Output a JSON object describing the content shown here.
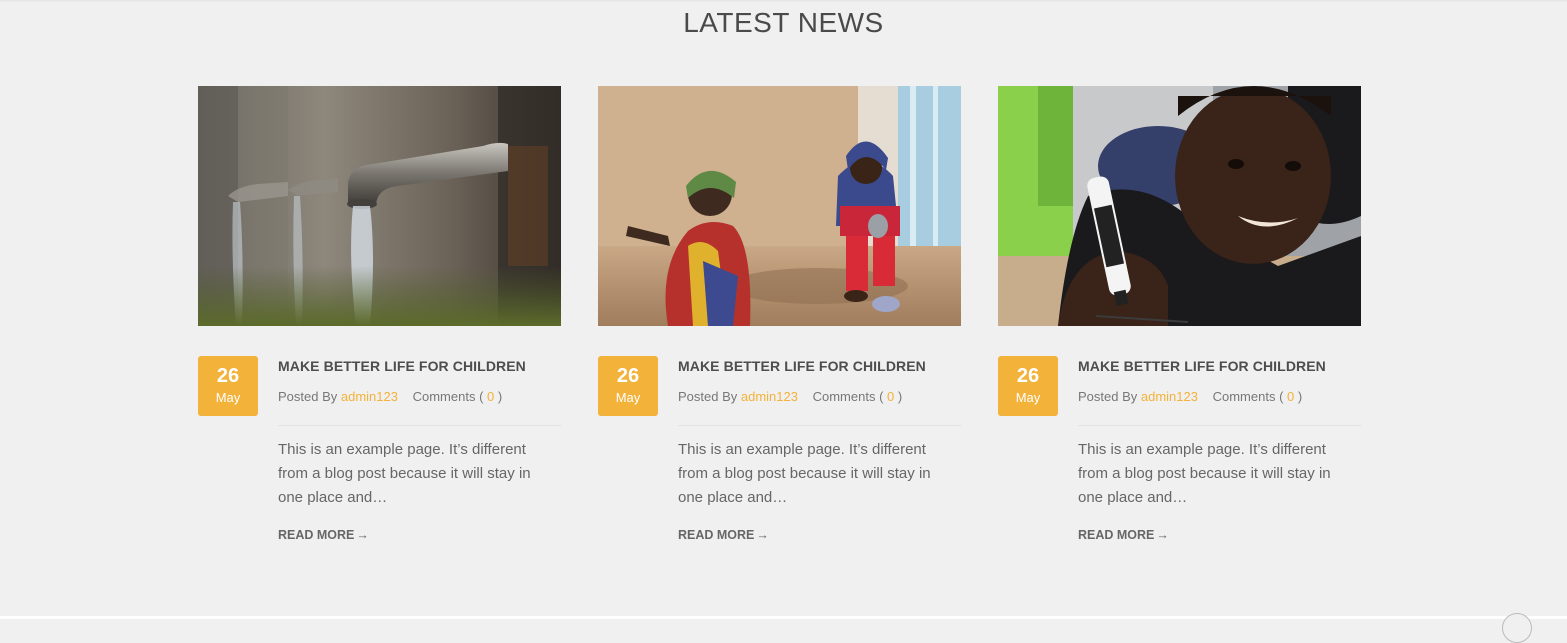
{
  "section": {
    "title": "LATEST NEWS"
  },
  "colors": {
    "accent": "#f3b23a",
    "background": "#f0f0f0",
    "heading": "#4a4a4a"
  },
  "posts": [
    {
      "image": "water-taps-photo",
      "day": "26",
      "month": "May",
      "title": "MAKE BETTER LIFE FOR CHILDREN",
      "posted_by_label": "Posted By",
      "author": "admin123",
      "comments_label": "Comments (",
      "comments_count": "0",
      "comments_close": ")",
      "excerpt": "This is an example page. It’s different from a blog post because it will stay in one place and…",
      "read_more": "READ MORE",
      "read_more_icon": "arrow-right-icon"
    },
    {
      "image": "woman-and-child-photo",
      "day": "26",
      "month": "May",
      "title": "MAKE BETTER LIFE FOR CHILDREN",
      "posted_by_label": "Posted By",
      "author": "admin123",
      "comments_label": "Comments (",
      "comments_count": "0",
      "comments_close": ")",
      "excerpt": "This is an example page. It’s different from a blog post because it will stay in one place and…",
      "read_more": "READ MORE",
      "read_more_icon": "arrow-right-icon"
    },
    {
      "image": "boy-with-marker-photo",
      "day": "26",
      "month": "May",
      "title": "MAKE BETTER LIFE FOR CHILDREN",
      "posted_by_label": "Posted By",
      "author": "admin123",
      "comments_label": "Comments (",
      "comments_count": "0",
      "comments_close": ")",
      "excerpt": "This is an example page. It’s different from a blog post because it will stay in one place and…",
      "read_more": "READ MORE",
      "read_more_icon": "arrow-right-icon"
    }
  ],
  "icons": {
    "scroll_top": "scroll-to-top-icon"
  }
}
